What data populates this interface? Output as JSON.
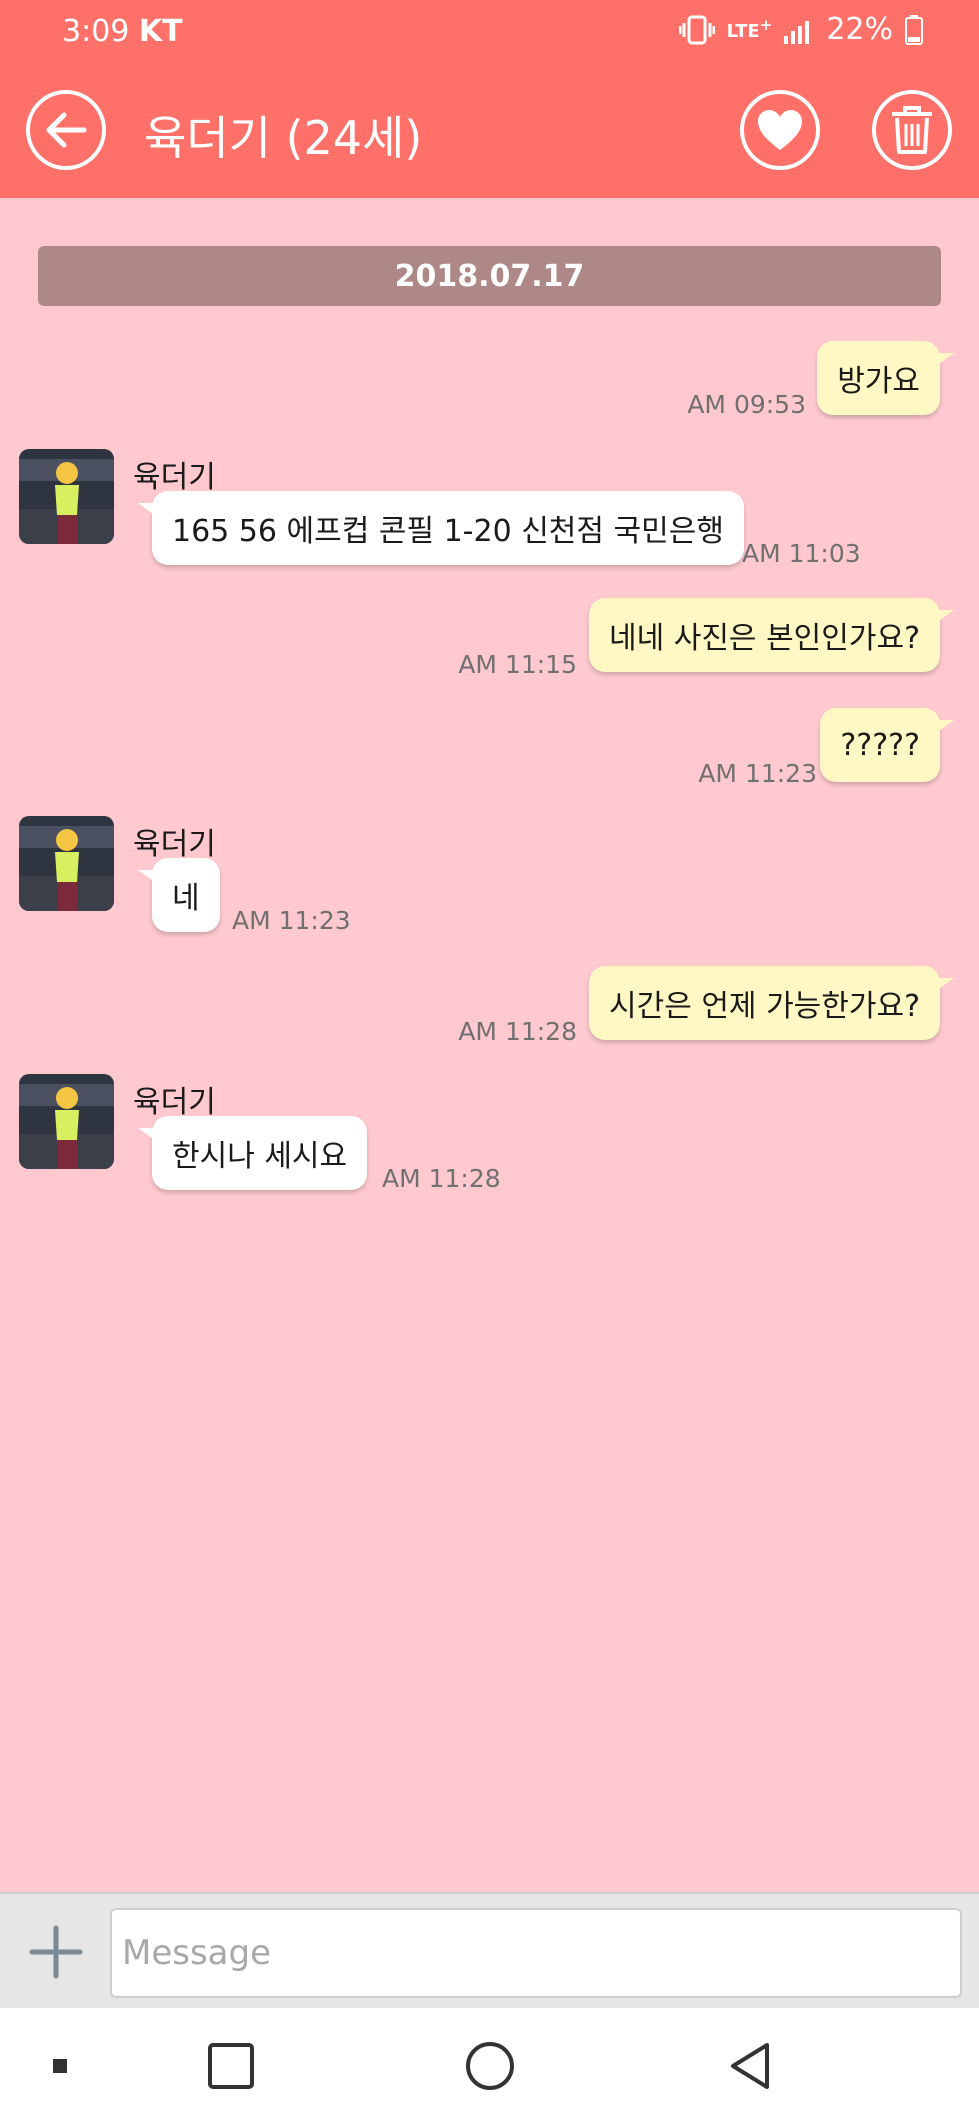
{
  "status_bar": {
    "time": "3:09",
    "carrier": "KT",
    "network": "LTE",
    "battery": "22%"
  },
  "app_bar": {
    "title": "육더기 (24세)",
    "icons": [
      "back-arrow-icon",
      "heart-icon",
      "trash-icon"
    ]
  },
  "chat": {
    "date": "2018.07.17",
    "messages": [
      {
        "dir": "out",
        "text": "방가요",
        "time": "AM 09:53"
      },
      {
        "dir": "in",
        "sender": "육더기",
        "text": "165 56 에프컵 콘필 1-20 신천점 국민은행",
        "time": "AM 11:03"
      },
      {
        "dir": "out",
        "text": "네네 사진은 본인인가요?",
        "time": "AM 11:15"
      },
      {
        "dir": "out",
        "text": "?????",
        "time": "AM 11:23"
      },
      {
        "dir": "in",
        "sender": "육더기",
        "text": "네",
        "time": "AM 11:23"
      },
      {
        "dir": "out",
        "text": "시간은 언제 가능한가요?",
        "time": "AM 11:28"
      },
      {
        "dir": "in",
        "sender": "육더기",
        "text": "한시나 세시요",
        "time": "AM 11:28"
      }
    ]
  },
  "input": {
    "placeholder": "Message",
    "value": ""
  },
  "colors": {
    "primary": "#ff7069",
    "chat_background": "#ffc9cf",
    "outgoing_bubble": "#fff8c4",
    "incoming_bubble": "#ffffff",
    "date_bar": "#ae8787"
  }
}
